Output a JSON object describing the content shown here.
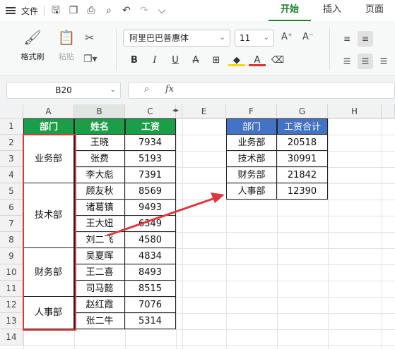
{
  "menu": {
    "file_label": "文件",
    "tabs": [
      {
        "label": "开始",
        "active": true
      },
      {
        "label": "插入",
        "active": false
      },
      {
        "label": "页面",
        "active": false
      }
    ]
  },
  "ribbon": {
    "format_painter_label": "格式刷",
    "paste_label": "粘贴",
    "font_name": "阿里巴巴普惠体",
    "font_size": "11",
    "font_grow": "A⁺",
    "font_shrink": "A⁻",
    "icons": [
      "format-painter-icon",
      "paste-icon",
      "cut-icon",
      "copy-icon",
      "bold-icon",
      "italic-icon",
      "underline-icon",
      "strikethrough-icon",
      "borders-icon",
      "fill-color-icon",
      "font-color-icon",
      "eraser-icon"
    ],
    "fill_color": "#ffd700",
    "font_color": "#e03030"
  },
  "formula_bar": {
    "name_box": "B20",
    "formula": ""
  },
  "colors": {
    "header_green": "#1a9e47",
    "header_blue": "#4472c4",
    "highlight_red": "#e0353f",
    "active_tab": "#1e7e34"
  },
  "columns": [
    "A",
    "B",
    "C",
    "",
    "E",
    "F",
    "G",
    "H"
  ],
  "rows": [
    "1",
    "2",
    "3",
    "4",
    "5",
    "6",
    "7",
    "8",
    "9",
    "10",
    "11",
    "12",
    "13",
    "14"
  ],
  "left_table": {
    "headers": [
      "部门",
      "姓名",
      "工资"
    ],
    "departments": [
      "业务部",
      "技术部",
      "财务部",
      "人事部"
    ],
    "records": [
      {
        "name": "王晓",
        "salary": "7934"
      },
      {
        "name": "张费",
        "salary": "5193"
      },
      {
        "name": "李大彪",
        "salary": "7391"
      },
      {
        "name": "顾友秋",
        "salary": "8569"
      },
      {
        "name": "诸葛镇",
        "salary": "9493"
      },
      {
        "name": "王大妞",
        "salary": "6349"
      },
      {
        "name": "刘二飞",
        "salary": "4580"
      },
      {
        "name": "吴夏晖",
        "salary": "4834"
      },
      {
        "name": "王二喜",
        "salary": "8493"
      },
      {
        "name": "司马懿",
        "salary": "8515"
      },
      {
        "name": "赵红霞",
        "salary": "7076"
      },
      {
        "name": "张二牛",
        "salary": "5314"
      }
    ]
  },
  "right_table": {
    "headers": [
      "部门",
      "工资合计"
    ],
    "rows": [
      {
        "dept": "业务部",
        "total": "20518"
      },
      {
        "dept": "技术部",
        "total": "30991"
      },
      {
        "dept": "财务部",
        "total": "21842"
      },
      {
        "dept": "人事部",
        "total": "12390"
      }
    ]
  }
}
